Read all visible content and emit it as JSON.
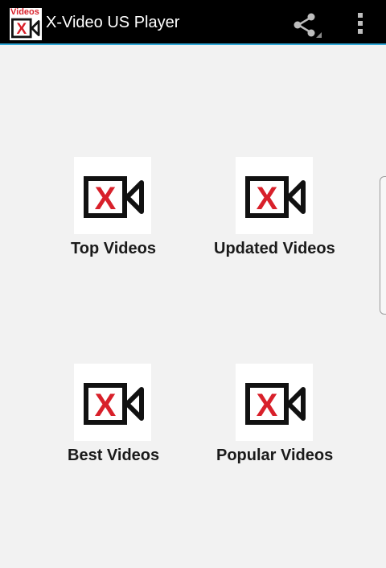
{
  "action_bar": {
    "app_icon_text": "Videos",
    "title": "X-Video US Player",
    "share_icon": "share-icon",
    "overflow_icon": "overflow-menu-icon",
    "accent_color": "#2fa8d8"
  },
  "tiles": [
    {
      "label": "Top Videos",
      "icon": "video-camera-x-icon"
    },
    {
      "label": "Updated Videos",
      "icon": "video-camera-x-icon"
    },
    {
      "label": "Best Videos",
      "icon": "video-camera-x-icon"
    },
    {
      "label": "Popular Videos",
      "icon": "video-camera-x-icon"
    }
  ],
  "colors": {
    "background": "#f2f2f2",
    "icon_red": "#d8202a",
    "icon_black": "#111111"
  }
}
